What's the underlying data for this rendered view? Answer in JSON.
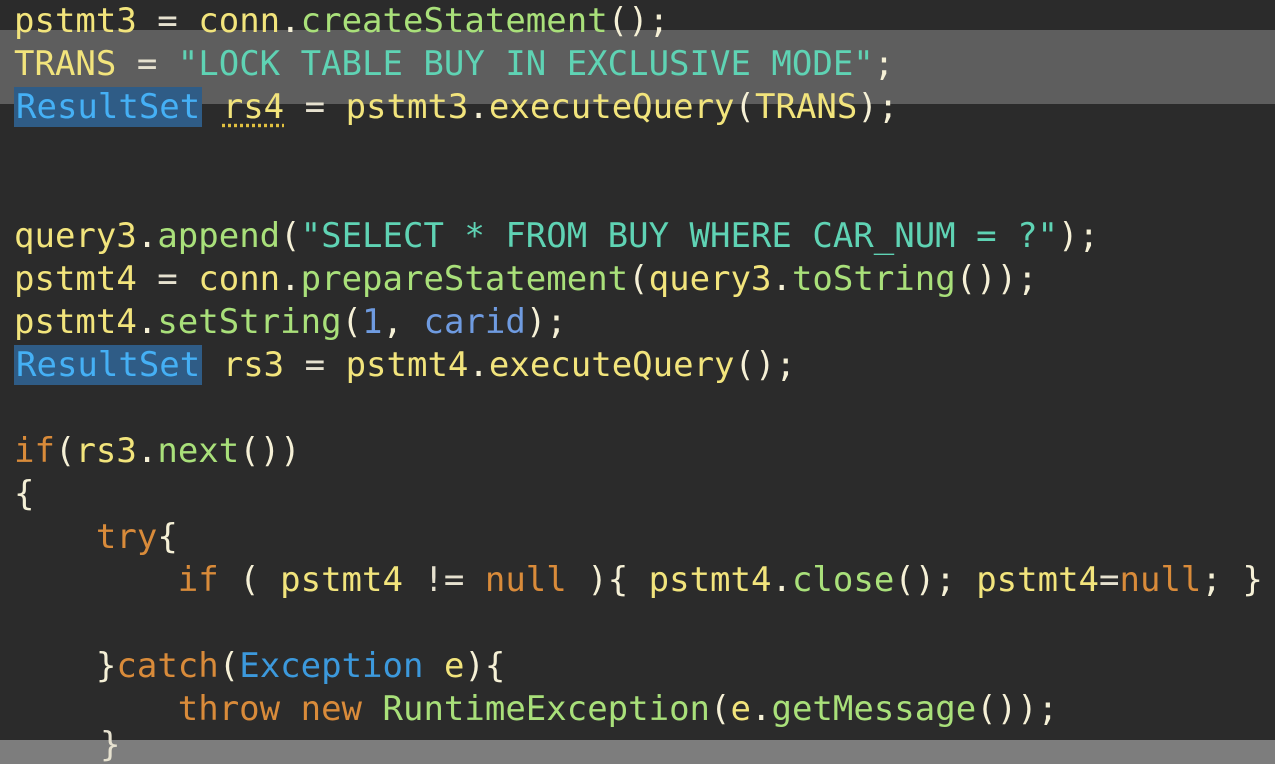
{
  "editor": {
    "lines": [
      {
        "tokens": [
          {
            "text": "pstmt3",
            "cls": "ident"
          },
          {
            "text": " = ",
            "cls": "plain"
          },
          {
            "text": "conn",
            "cls": "ident"
          },
          {
            "text": ".",
            "cls": "punct"
          },
          {
            "text": "createStatement",
            "cls": "method"
          },
          {
            "text": "();",
            "cls": "punct"
          }
        ]
      },
      {
        "tokens": [
          {
            "text": "TRANS",
            "cls": "ident"
          },
          {
            "text": " = ",
            "cls": "plain"
          },
          {
            "text": "\"LOCK TABLE BUY IN EXCLUSIVE MODE\"",
            "cls": "string"
          },
          {
            "text": ";",
            "cls": "punct"
          }
        ]
      },
      {
        "tokens": [
          {
            "text": "ResultSet",
            "cls": "type-hl"
          },
          {
            "text": " ",
            "cls": "plain"
          },
          {
            "text": "rs4",
            "cls": "warn"
          },
          {
            "text": " = ",
            "cls": "plain"
          },
          {
            "text": "pstmt3",
            "cls": "ident"
          },
          {
            "text": ".",
            "cls": "punct"
          },
          {
            "text": "executeQuery",
            "cls": "ident"
          },
          {
            "text": "(",
            "cls": "punct"
          },
          {
            "text": "TRANS",
            "cls": "ident"
          },
          {
            "text": ");",
            "cls": "punct"
          }
        ]
      },
      {
        "tokens": []
      },
      {
        "tokens": []
      },
      {
        "tokens": [
          {
            "text": "query3",
            "cls": "ident"
          },
          {
            "text": ".",
            "cls": "punct"
          },
          {
            "text": "append",
            "cls": "method"
          },
          {
            "text": "(",
            "cls": "punct"
          },
          {
            "text": "\"SELECT * FROM BUY WHERE CAR_NUM = ?\"",
            "cls": "string"
          },
          {
            "text": ");",
            "cls": "punct"
          }
        ]
      },
      {
        "tokens": [
          {
            "text": "pstmt4",
            "cls": "ident"
          },
          {
            "text": " = ",
            "cls": "plain"
          },
          {
            "text": "conn",
            "cls": "ident"
          },
          {
            "text": ".",
            "cls": "punct"
          },
          {
            "text": "prepareStatement",
            "cls": "method"
          },
          {
            "text": "(",
            "cls": "punct"
          },
          {
            "text": "query3",
            "cls": "ident"
          },
          {
            "text": ".",
            "cls": "punct"
          },
          {
            "text": "toString",
            "cls": "method"
          },
          {
            "text": "());",
            "cls": "punct"
          }
        ]
      },
      {
        "tokens": [
          {
            "text": "pstmt4",
            "cls": "ident"
          },
          {
            "text": ".",
            "cls": "punct"
          },
          {
            "text": "setString",
            "cls": "method"
          },
          {
            "text": "(",
            "cls": "punct"
          },
          {
            "text": "1",
            "cls": "number"
          },
          {
            "text": ", ",
            "cls": "punct"
          },
          {
            "text": "carid",
            "cls": "param"
          },
          {
            "text": ");",
            "cls": "punct"
          }
        ]
      },
      {
        "tokens": [
          {
            "text": "ResultSet",
            "cls": "type-hl"
          },
          {
            "text": " ",
            "cls": "plain"
          },
          {
            "text": "rs3",
            "cls": "ident"
          },
          {
            "text": " = ",
            "cls": "plain"
          },
          {
            "text": "pstmt4",
            "cls": "ident"
          },
          {
            "text": ".",
            "cls": "punct"
          },
          {
            "text": "executeQuery",
            "cls": "ident"
          },
          {
            "text": "();",
            "cls": "punct"
          }
        ]
      },
      {
        "tokens": []
      },
      {
        "tokens": [
          {
            "text": "if",
            "cls": "keyword"
          },
          {
            "text": "(",
            "cls": "punct"
          },
          {
            "text": "rs3",
            "cls": "ident"
          },
          {
            "text": ".",
            "cls": "punct"
          },
          {
            "text": "next",
            "cls": "method"
          },
          {
            "text": "())",
            "cls": "punct"
          }
        ]
      },
      {
        "tokens": [
          {
            "text": "{",
            "cls": "punct"
          }
        ]
      },
      {
        "tokens": [
          {
            "text": "    ",
            "cls": "plain"
          },
          {
            "text": "try",
            "cls": "keyword"
          },
          {
            "text": "{",
            "cls": "punct"
          }
        ]
      },
      {
        "tokens": [
          {
            "text": "        ",
            "cls": "plain"
          },
          {
            "text": "if",
            "cls": "keyword"
          },
          {
            "text": " ( ",
            "cls": "punct"
          },
          {
            "text": "pstmt4",
            "cls": "ident"
          },
          {
            "text": " != ",
            "cls": "plain"
          },
          {
            "text": "null",
            "cls": "keyword"
          },
          {
            "text": " ){ ",
            "cls": "punct"
          },
          {
            "text": "pstmt4",
            "cls": "ident"
          },
          {
            "text": ".",
            "cls": "punct"
          },
          {
            "text": "close",
            "cls": "method"
          },
          {
            "text": "(); ",
            "cls": "punct"
          },
          {
            "text": "pstmt4",
            "cls": "ident"
          },
          {
            "text": "=",
            "cls": "plain"
          },
          {
            "text": "null",
            "cls": "keyword"
          },
          {
            "text": "; }",
            "cls": "punct"
          }
        ]
      },
      {
        "tokens": []
      },
      {
        "tokens": [
          {
            "text": "    ",
            "cls": "plain"
          },
          {
            "text": "}",
            "cls": "punct"
          },
          {
            "text": "catch",
            "cls": "keyword"
          },
          {
            "text": "(",
            "cls": "punct"
          },
          {
            "text": "Exception",
            "cls": "classname"
          },
          {
            "text": " ",
            "cls": "plain"
          },
          {
            "text": "e",
            "cls": "ident"
          },
          {
            "text": "){",
            "cls": "punct"
          }
        ]
      },
      {
        "tokens": [
          {
            "text": "        ",
            "cls": "plain"
          },
          {
            "text": "throw",
            "cls": "keyword"
          },
          {
            "text": " ",
            "cls": "plain"
          },
          {
            "text": "new",
            "cls": "keyword"
          },
          {
            "text": " ",
            "cls": "plain"
          },
          {
            "text": "RuntimeException",
            "cls": "method"
          },
          {
            "text": "(",
            "cls": "punct"
          },
          {
            "text": "e",
            "cls": "ident"
          },
          {
            "text": ".",
            "cls": "punct"
          },
          {
            "text": "getMessage",
            "cls": "method"
          },
          {
            "text": "());",
            "cls": "punct"
          }
        ]
      }
    ],
    "partial_bottom_char": "}"
  }
}
